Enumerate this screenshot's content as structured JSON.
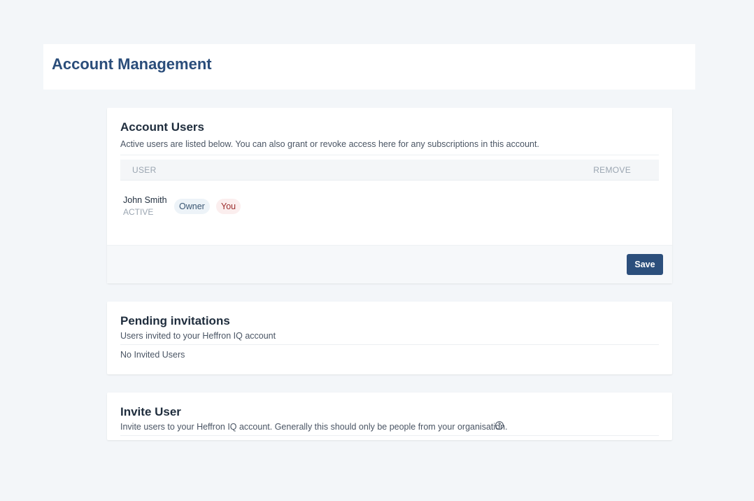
{
  "header": {
    "title": "Account Management"
  },
  "account_users": {
    "title": "Account Users",
    "subtitle": "Active users are listed below. You can also grant or revoke access here for any subscriptions in this account.",
    "columns": {
      "user": "USER",
      "remove": "REMOVE"
    },
    "rows": [
      {
        "name": "John Smith",
        "status": "ACTIVE",
        "role_badge": "Owner",
        "self_badge": "You"
      }
    ],
    "save_label": "Save"
  },
  "pending_invitations": {
    "title": "Pending invitations",
    "subtitle": "Users invited to your Heffron IQ account",
    "empty_text": "No Invited Users"
  },
  "invite_user": {
    "title": "Invite User",
    "subtitle": "Invite users to your Heffron IQ account. Generally this should only be people from your organisation.",
    "help_icon": "question-circle-icon"
  },
  "colors": {
    "brand": "#2a4d7a",
    "button": "#2c4f7c",
    "background": "#f3f6f9"
  }
}
